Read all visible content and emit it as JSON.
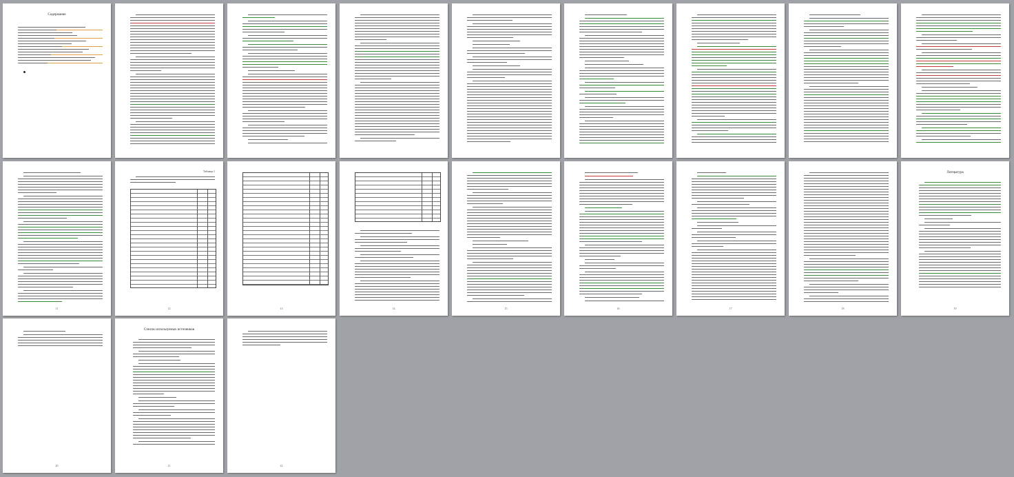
{
  "document": {
    "page_count": 21,
    "pages": [
      {
        "title": "Содержание",
        "page_number": ""
      },
      {
        "title": "",
        "page_number": ""
      },
      {
        "title": "",
        "page_number": ""
      },
      {
        "title": "",
        "page_number": ""
      },
      {
        "title": "",
        "page_number": ""
      },
      {
        "title": "",
        "page_number": ""
      },
      {
        "title": "",
        "page_number": ""
      },
      {
        "title": "",
        "page_number": ""
      },
      {
        "title": "",
        "page_number": ""
      },
      {
        "title": "",
        "page_number": "11"
      },
      {
        "title": "",
        "corner": "Таблица 1",
        "page_number": "12"
      },
      {
        "title": "",
        "page_number": "13"
      },
      {
        "title": "",
        "page_number": "14"
      },
      {
        "title": "",
        "page_number": "15"
      },
      {
        "title": "",
        "page_number": "16"
      },
      {
        "title": "",
        "page_number": "17"
      },
      {
        "title": "",
        "page_number": "18"
      },
      {
        "title": "Литература",
        "page_number": "19"
      },
      {
        "title": "",
        "page_number": "20"
      },
      {
        "title": "Список используемых источников",
        "page_number": "21"
      },
      {
        "title": "",
        "page_number": "22"
      }
    ]
  }
}
